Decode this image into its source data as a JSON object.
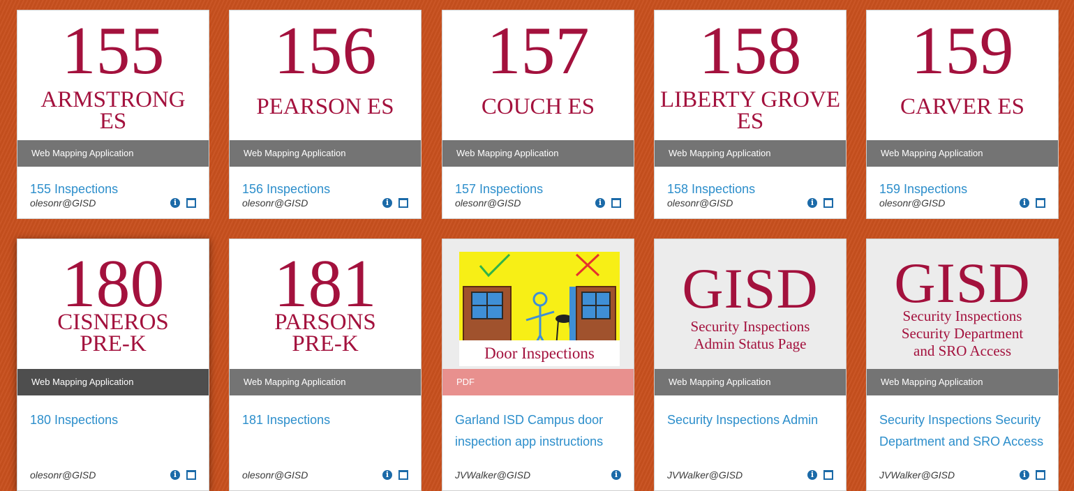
{
  "theme": {
    "page_bg": "#c8501e",
    "maroon": "#a3113d",
    "link_blue": "#2c8ecb",
    "icon_blue": "#1b6aa8",
    "bar_gray": "#747474",
    "pdf_pink": "#e8908e"
  },
  "cards": [
    {
      "thumb_number": "155",
      "thumb_lines": [
        "ARMSTRONG",
        "ES"
      ],
      "type": "Web Mapping Application",
      "title": "155 Inspections",
      "owner": "olesonr@GISD",
      "icons": [
        "info-icon",
        "window-icon"
      ]
    },
    {
      "thumb_number": "156",
      "thumb_lines": [
        "PEARSON ES"
      ],
      "type": "Web Mapping Application",
      "title": "156 Inspections",
      "owner": "olesonr@GISD",
      "icons": [
        "info-icon",
        "window-icon"
      ]
    },
    {
      "thumb_number": "157",
      "thumb_lines": [
        "COUCH ES"
      ],
      "type": "Web Mapping Application",
      "title": "157 Inspections",
      "owner": "olesonr@GISD",
      "icons": [
        "info-icon",
        "window-icon"
      ]
    },
    {
      "thumb_number": "158",
      "thumb_lines": [
        "LIBERTY GROVE",
        "ES"
      ],
      "type": "Web Mapping Application",
      "title": "158 Inspections",
      "owner": "olesonr@GISD",
      "icons": [
        "info-icon",
        "window-icon"
      ]
    },
    {
      "thumb_number": "159",
      "thumb_lines": [
        "CARVER ES"
      ],
      "type": "Web Mapping Application",
      "title": "159 Inspections",
      "owner": "olesonr@GISD",
      "icons": [
        "info-icon",
        "window-icon"
      ]
    },
    {
      "thumb_number": "180",
      "thumb_lines": [
        "CISNEROS",
        "PRE-K"
      ],
      "type": "Web Mapping Application",
      "title": "180 Inspections",
      "owner": "olesonr@GISD",
      "icons": [
        "info-icon",
        "window-icon"
      ]
    },
    {
      "thumb_number": "181",
      "thumb_lines": [
        "PARSONS",
        "PRE-K"
      ],
      "type": "Web Mapping Application",
      "title": "181 Inspections",
      "owner": "olesonr@GISD",
      "icons": [
        "info-icon",
        "window-icon"
      ]
    },
    {
      "thumb_caption": "Door Inspections",
      "type": "PDF",
      "title": "Garland ISD Campus door inspection app instructions",
      "owner": "JVWalker@GISD",
      "icons": [
        "info-icon"
      ]
    },
    {
      "thumb_logo": "GISD",
      "thumb_lines": [
        "Security Inspections",
        "Admin Status Page"
      ],
      "type": "Web Mapping Application",
      "title": "Security Inspections Admin",
      "owner": "JVWalker@GISD",
      "icons": [
        "info-icon",
        "window-icon"
      ]
    },
    {
      "thumb_logo": "GISD",
      "thumb_lines": [
        "Security Inspections",
        "Security Department",
        "and SRO Access"
      ],
      "type": "Web Mapping Application",
      "title": "Security Inspections Security Department and SRO Access",
      "owner": "JVWalker@GISD",
      "icons": [
        "info-icon",
        "window-icon"
      ]
    }
  ]
}
